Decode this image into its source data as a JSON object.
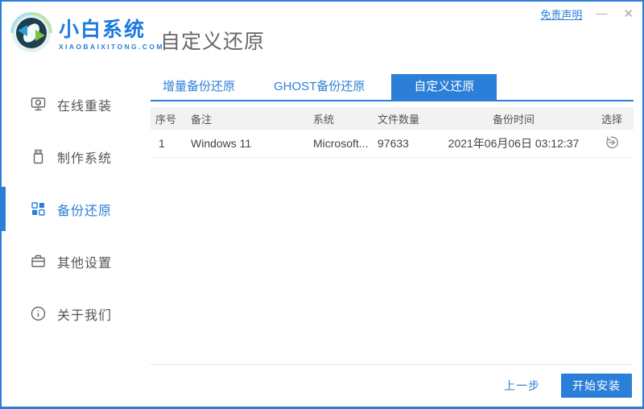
{
  "titlebar": {
    "disclaimer": "免责声明",
    "minimize_glyph": "—",
    "close_glyph": "✕"
  },
  "brand": {
    "name": "小白系统",
    "domain": "XIAOBAIXITONG.COM",
    "logo_icon": "recycle-arrows-logo"
  },
  "page": {
    "title": "自定义还原"
  },
  "sidebar": {
    "items": [
      {
        "label": "在线重装",
        "icon": "monitor-reinstall-icon",
        "active": false
      },
      {
        "label": "制作系统",
        "icon": "usb-drive-icon",
        "active": false
      },
      {
        "label": "备份还原",
        "icon": "modules-grid-icon",
        "active": true
      },
      {
        "label": "其他设置",
        "icon": "toolbox-icon",
        "active": false
      },
      {
        "label": "关于我们",
        "icon": "info-circle-icon",
        "active": false
      }
    ]
  },
  "tabs": {
    "items": [
      {
        "label": "增量备份还原",
        "active": false
      },
      {
        "label": "GHOST备份还原",
        "active": false
      },
      {
        "label": "自定义还原",
        "active": true
      }
    ]
  },
  "table": {
    "headers": [
      "序号",
      "备注",
      "系统",
      "文件数量",
      "备份时间",
      "选择"
    ],
    "rows": [
      {
        "seq": "1",
        "note": "Windows 11",
        "system": "Microsoft...",
        "file_count": "97633",
        "backup_time": "2021年06月06日 03:12:37",
        "action_icon": "restore-history-icon"
      }
    ]
  },
  "footer": {
    "previous": "上一步",
    "install": "开始安装"
  },
  "colors": {
    "accent": "#2b7fd8",
    "title_gray": "#666666",
    "table_header_bg": "#f2f2f2"
  }
}
